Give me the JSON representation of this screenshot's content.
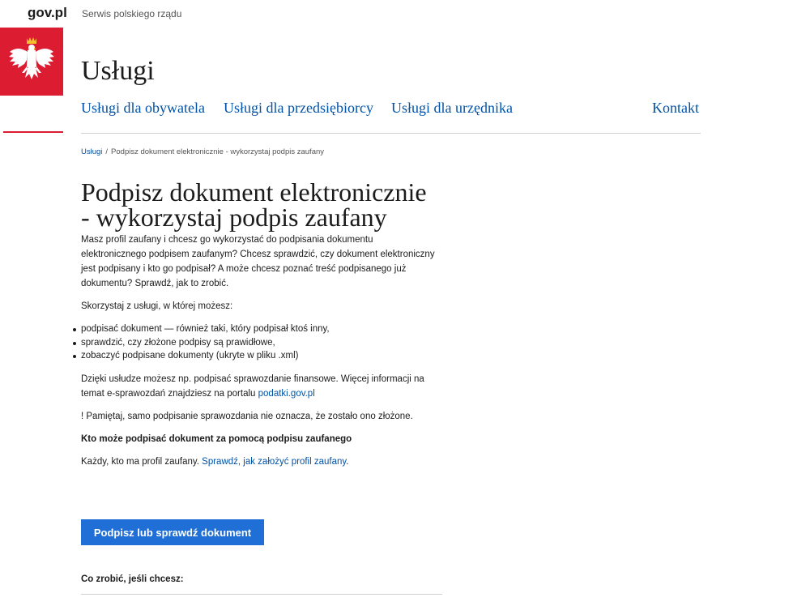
{
  "brand": {
    "logo_text": "gov.pl",
    "tagline": "Serwis polskiego rządu"
  },
  "site": {
    "title": "Usługi"
  },
  "nav": {
    "items": [
      {
        "label": "Usługi dla obywatela"
      },
      {
        "label": "Usługi dla przedsiębiorcy"
      },
      {
        "label": "Usługi dla urzędnika"
      },
      {
        "label": "Kontakt"
      }
    ]
  },
  "breadcrumb": {
    "root": "Usługi",
    "separator": "/",
    "current": "Podpisz dokument elektronicznie - wykorzystaj podpis zaufany"
  },
  "page": {
    "title": "Podpisz dokument elektronicznie - wykorzystaj podpis zaufany",
    "intro": "Masz profil zaufany i chcesz go wykorzystać do podpisania dokumentu elektronicznego podpisem zaufanym? Chcesz sprawdzić, czy dokument elektroniczny jest podpisany i kto go podpisał? A może chcesz poznać treść podpisanego już dokumentu? Sprawdź, jak to zrobić.",
    "lead": "Skorzystaj z usługi, w której możesz:",
    "features": [
      "podpisać dokument — również taki, który podpisał ktoś inny,",
      "sprawdzić, czy złożone podpisy są prawidłowe,",
      "zobaczyć podpisane dokumenty (ukryte w pliku .xml)"
    ],
    "info_text": "Dzięki usłudze możesz np. podpisać sprawozdanie finansowe. Więcej informacji na temat e-sprawozdań znajdziesz na portalu",
    "info_link": "podatki.gov.pl",
    "reminder": "! Pamiętaj, samo podpisanie sprawozdania nie oznacza, że zostało ono złożone.",
    "who_title": "Kto może podpisać dokument za pomocą podpisu zaufanego",
    "who_text": "Każdy, kto ma profil zaufany.",
    "who_link": "Sprawdź, jak założyć profil zaufany",
    "who_end": ".",
    "cta_label": "Podpisz lub sprawdź dokument",
    "what_title": "Co zrobić, jeśli chcesz:"
  },
  "colors": {
    "brand_red": "#dc1c30",
    "link_blue": "#0052a5",
    "button_blue": "#1f6fd6"
  },
  "icons": {
    "emblem": "polish-eagle-emblem-icon"
  }
}
